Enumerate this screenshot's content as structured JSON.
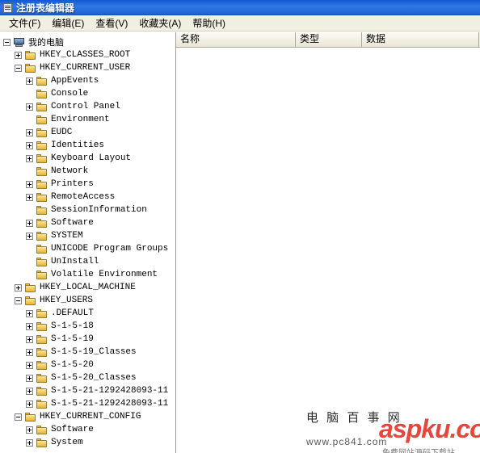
{
  "window": {
    "title": "注册表编辑器",
    "icon": "registry-editor-icon"
  },
  "menu": {
    "items": [
      {
        "label": "文件(F)",
        "name": "menu-file"
      },
      {
        "label": "编辑(E)",
        "name": "menu-edit"
      },
      {
        "label": "查看(V)",
        "name": "menu-view"
      },
      {
        "label": "收藏夹(A)",
        "name": "menu-favorites"
      },
      {
        "label": "帮助(H)",
        "name": "menu-help"
      }
    ]
  },
  "columns": [
    {
      "label": "名称"
    },
    {
      "label": "类型"
    },
    {
      "label": "数据"
    }
  ],
  "tree": [
    {
      "label": "我的电脑",
      "level": 0,
      "icon": "computer",
      "expander": "minus",
      "selected": false
    },
    {
      "label": "HKEY_CLASSES_ROOT",
      "level": 1,
      "icon": "folder",
      "expander": "plus",
      "selected": false
    },
    {
      "label": "HKEY_CURRENT_USER",
      "level": 1,
      "icon": "folder",
      "expander": "minus",
      "selected": false
    },
    {
      "label": "AppEvents",
      "level": 2,
      "icon": "folder",
      "expander": "plus",
      "selected": false
    },
    {
      "label": "Console",
      "level": 2,
      "icon": "folder",
      "expander": "none",
      "selected": false
    },
    {
      "label": "Control Panel",
      "level": 2,
      "icon": "folder",
      "expander": "plus",
      "selected": false
    },
    {
      "label": "Environment",
      "level": 2,
      "icon": "folder",
      "expander": "none",
      "selected": false
    },
    {
      "label": "EUDC",
      "level": 2,
      "icon": "folder",
      "expander": "plus",
      "selected": false
    },
    {
      "label": "Identities",
      "level": 2,
      "icon": "folder",
      "expander": "plus",
      "selected": false
    },
    {
      "label": "Keyboard Layout",
      "level": 2,
      "icon": "folder",
      "expander": "plus",
      "selected": false
    },
    {
      "label": "Network",
      "level": 2,
      "icon": "folder",
      "expander": "none",
      "selected": false
    },
    {
      "label": "Printers",
      "level": 2,
      "icon": "folder",
      "expander": "plus",
      "selected": false
    },
    {
      "label": "RemoteAccess",
      "level": 2,
      "icon": "folder",
      "expander": "plus",
      "selected": false
    },
    {
      "label": "SessionInformation",
      "level": 2,
      "icon": "folder",
      "expander": "none",
      "selected": false
    },
    {
      "label": "Software",
      "level": 2,
      "icon": "folder",
      "expander": "plus",
      "selected": false
    },
    {
      "label": "SYSTEM",
      "level": 2,
      "icon": "folder",
      "expander": "plus",
      "selected": false
    },
    {
      "label": "UNICODE Program Groups",
      "level": 2,
      "icon": "folder",
      "expander": "none",
      "selected": false
    },
    {
      "label": "UnInstall",
      "level": 2,
      "icon": "folder",
      "expander": "none",
      "selected": false
    },
    {
      "label": "Volatile Environment",
      "level": 2,
      "icon": "folder",
      "expander": "none",
      "selected": false
    },
    {
      "label": "HKEY_LOCAL_MACHINE",
      "level": 1,
      "icon": "folder",
      "expander": "plus",
      "selected": false
    },
    {
      "label": "HKEY_USERS",
      "level": 1,
      "icon": "folder",
      "expander": "minus",
      "selected": false
    },
    {
      "label": ".DEFAULT",
      "level": 2,
      "icon": "folder",
      "expander": "plus",
      "selected": false
    },
    {
      "label": "S-1-5-18",
      "level": 2,
      "icon": "folder",
      "expander": "plus",
      "selected": false
    },
    {
      "label": "S-1-5-19",
      "level": 2,
      "icon": "folder",
      "expander": "plus",
      "selected": false
    },
    {
      "label": "S-1-5-19_Classes",
      "level": 2,
      "icon": "folder",
      "expander": "plus",
      "selected": false
    },
    {
      "label": "S-1-5-20",
      "level": 2,
      "icon": "folder",
      "expander": "plus",
      "selected": false
    },
    {
      "label": "S-1-5-20_Classes",
      "level": 2,
      "icon": "folder",
      "expander": "plus",
      "selected": false
    },
    {
      "label": "S-1-5-21-1292428093-11",
      "level": 2,
      "icon": "folder",
      "expander": "plus",
      "selected": false
    },
    {
      "label": "S-1-5-21-1292428093-11",
      "level": 2,
      "icon": "folder",
      "expander": "plus",
      "selected": false
    },
    {
      "label": "HKEY_CURRENT_CONFIG",
      "level": 1,
      "icon": "folder",
      "expander": "minus",
      "selected": false
    },
    {
      "label": "Software",
      "level": 2,
      "icon": "folder",
      "expander": "plus",
      "selected": false
    },
    {
      "label": "System",
      "level": 2,
      "icon": "folder",
      "expander": "plus",
      "selected": false
    }
  ],
  "watermark": {
    "cn_text": "电 脑 百 事 网",
    "logo": "aspku.com",
    "url": "www.pc841.com",
    "sub": "免费网站源码下载站"
  }
}
